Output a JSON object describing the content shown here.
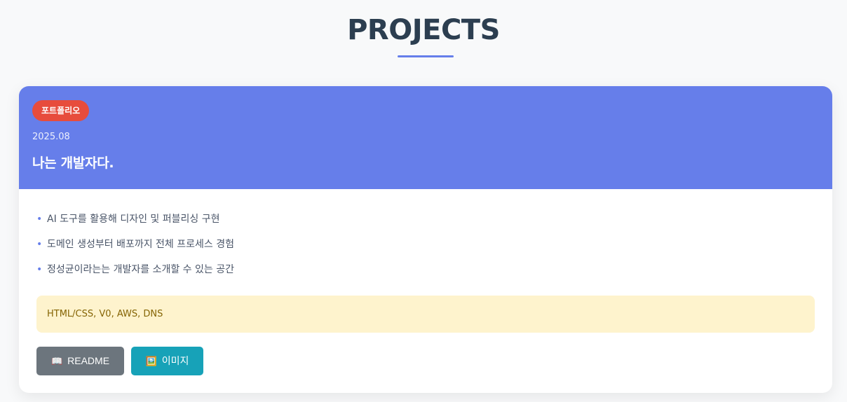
{
  "section": {
    "title": "PROJECTS"
  },
  "project": {
    "badge": "포트폴리오",
    "date": "2025.08",
    "title": "나는 개발자다.",
    "bullets": [
      "AI 도구를 활용해 디자인 및 퍼블리싱 구현",
      "도메인 생성부터 배포까지 전체 프로세스 경험",
      "정성균이라는는 개발자를 소개할 수 있는 공간"
    ],
    "tech_stack": "HTML/CSS, V0, AWS, DNS",
    "buttons": {
      "readme_label": "README",
      "readme_icon": "📖",
      "image_label": "이미지",
      "image_icon": "🖼️"
    }
  },
  "colors": {
    "header_bg": "#667eea",
    "badge_bg": "#e74c3c",
    "readme_btn": "#6c757d",
    "image_btn": "#17a2b8",
    "tech_bg": "#fef3cd"
  }
}
